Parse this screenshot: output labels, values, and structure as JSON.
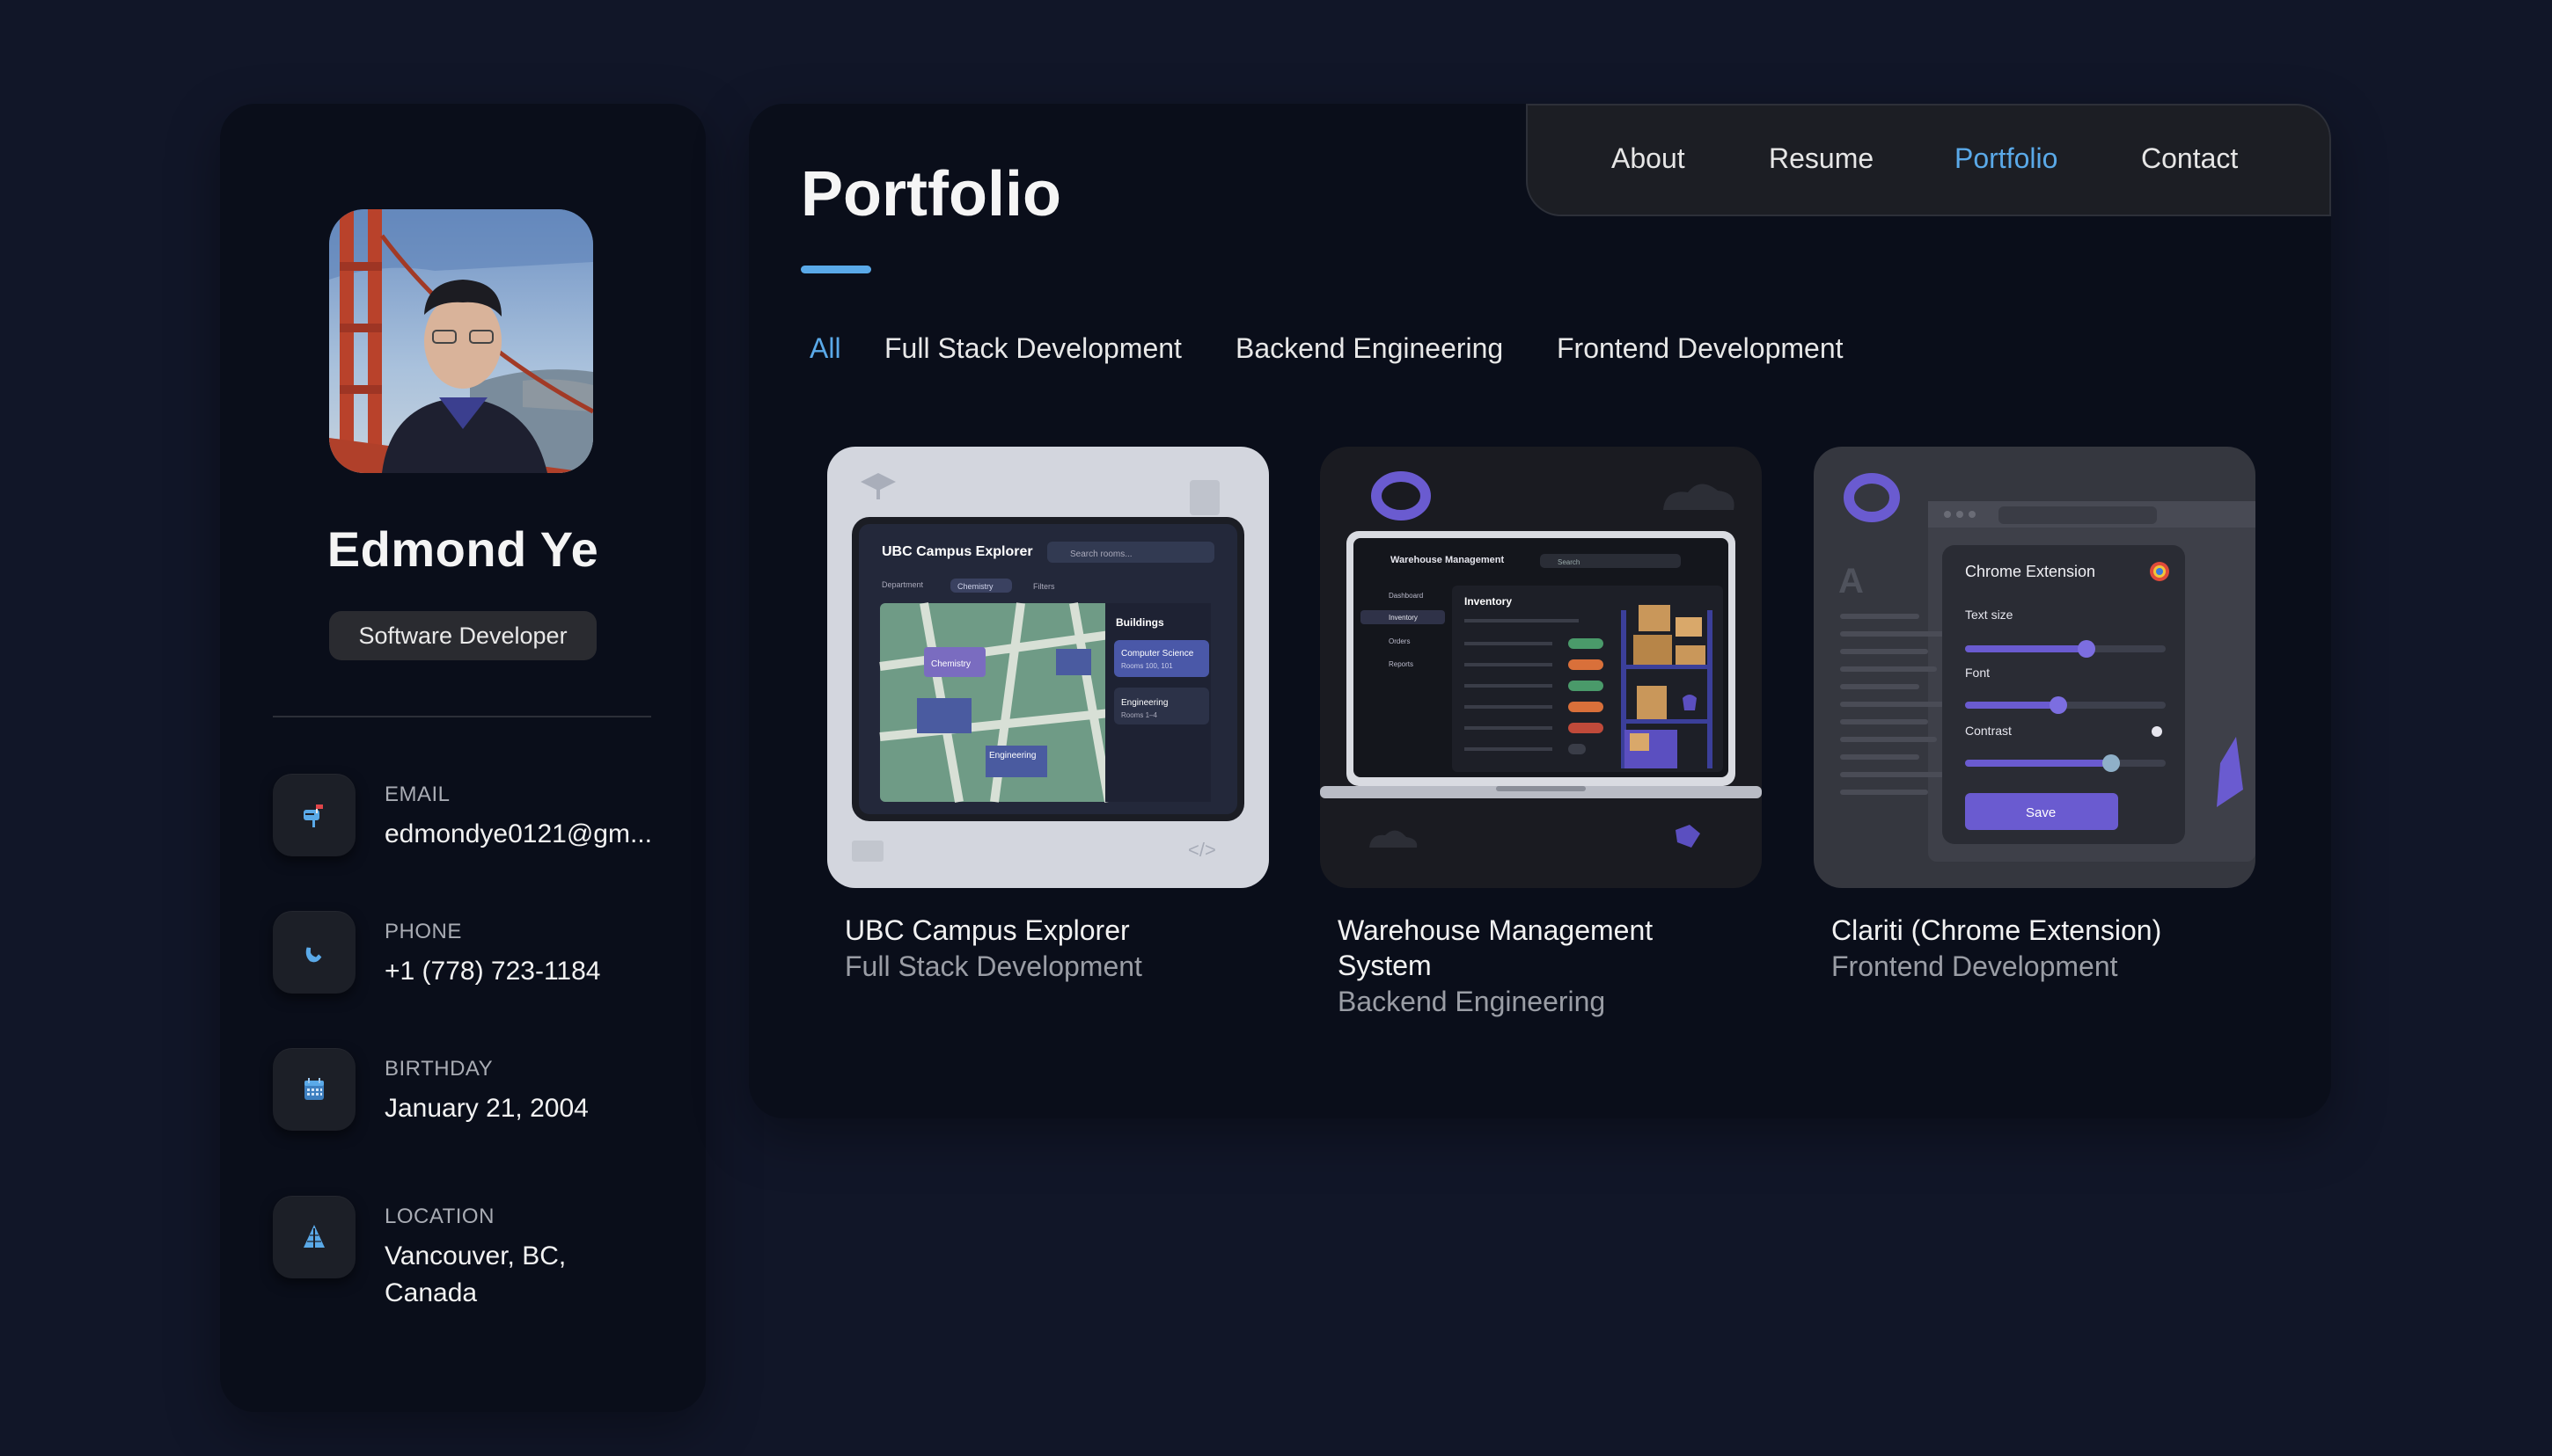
{
  "colors": {
    "background": "#111628",
    "card": "#0a0e1a",
    "accent": "#5aa9e8"
  },
  "profile": {
    "name": "Edmond Ye",
    "title": "Software Developer"
  },
  "contacts": [
    {
      "icon": "mailbox-icon",
      "label": "EMAIL",
      "value": "edmondye0121@gm..."
    },
    {
      "icon": "phone-icon",
      "label": "PHONE",
      "value": "+1 (778) 723-1184"
    },
    {
      "icon": "calendar-icon",
      "label": "BIRTHDAY",
      "value": "January 21, 2004"
    },
    {
      "icon": "location-icon",
      "label": "LOCATION",
      "value": "Vancouver, BC, Canada"
    }
  ],
  "nav": {
    "items": [
      "About",
      "Resume",
      "Portfolio",
      "Contact"
    ],
    "active": "Portfolio"
  },
  "page": {
    "title": "Portfolio"
  },
  "filters": {
    "items": [
      "All",
      "Full Stack Development",
      "Backend Engineering",
      "Frontend Development"
    ],
    "active": "All"
  },
  "projects": [
    {
      "title": "UBC Campus Explorer",
      "category": "Full Stack Development",
      "thumb": {
        "app_title": "UBC Campus Explorer",
        "search": "Search rooms...",
        "dept": "Department",
        "chip": "Chemistry",
        "filters": "Filters",
        "panel_title": "Buildings",
        "b1": "Computer Science",
        "b1_sub": "Rooms 100, 101",
        "b2": "Engineering",
        "b2_sub": "Rooms 1–4",
        "map_label1": "Chemistry",
        "map_label2": "Engineering"
      }
    },
    {
      "title": "Warehouse Management System",
      "category": "Backend Engineering",
      "thumb": {
        "app_title": "Warehouse Management",
        "search": "Search",
        "nav1": "Dashboard",
        "nav2": "Inventory",
        "nav3": "Orders",
        "nav4": "Reports",
        "table_title": "Inventory"
      }
    },
    {
      "title": "Clariti (Chrome Extension)",
      "category": "Frontend Development",
      "thumb": {
        "panel_title": "Chrome Extension",
        "s1": "Text size",
        "s2": "Font",
        "s3": "Contrast",
        "button": "Save"
      }
    }
  ]
}
